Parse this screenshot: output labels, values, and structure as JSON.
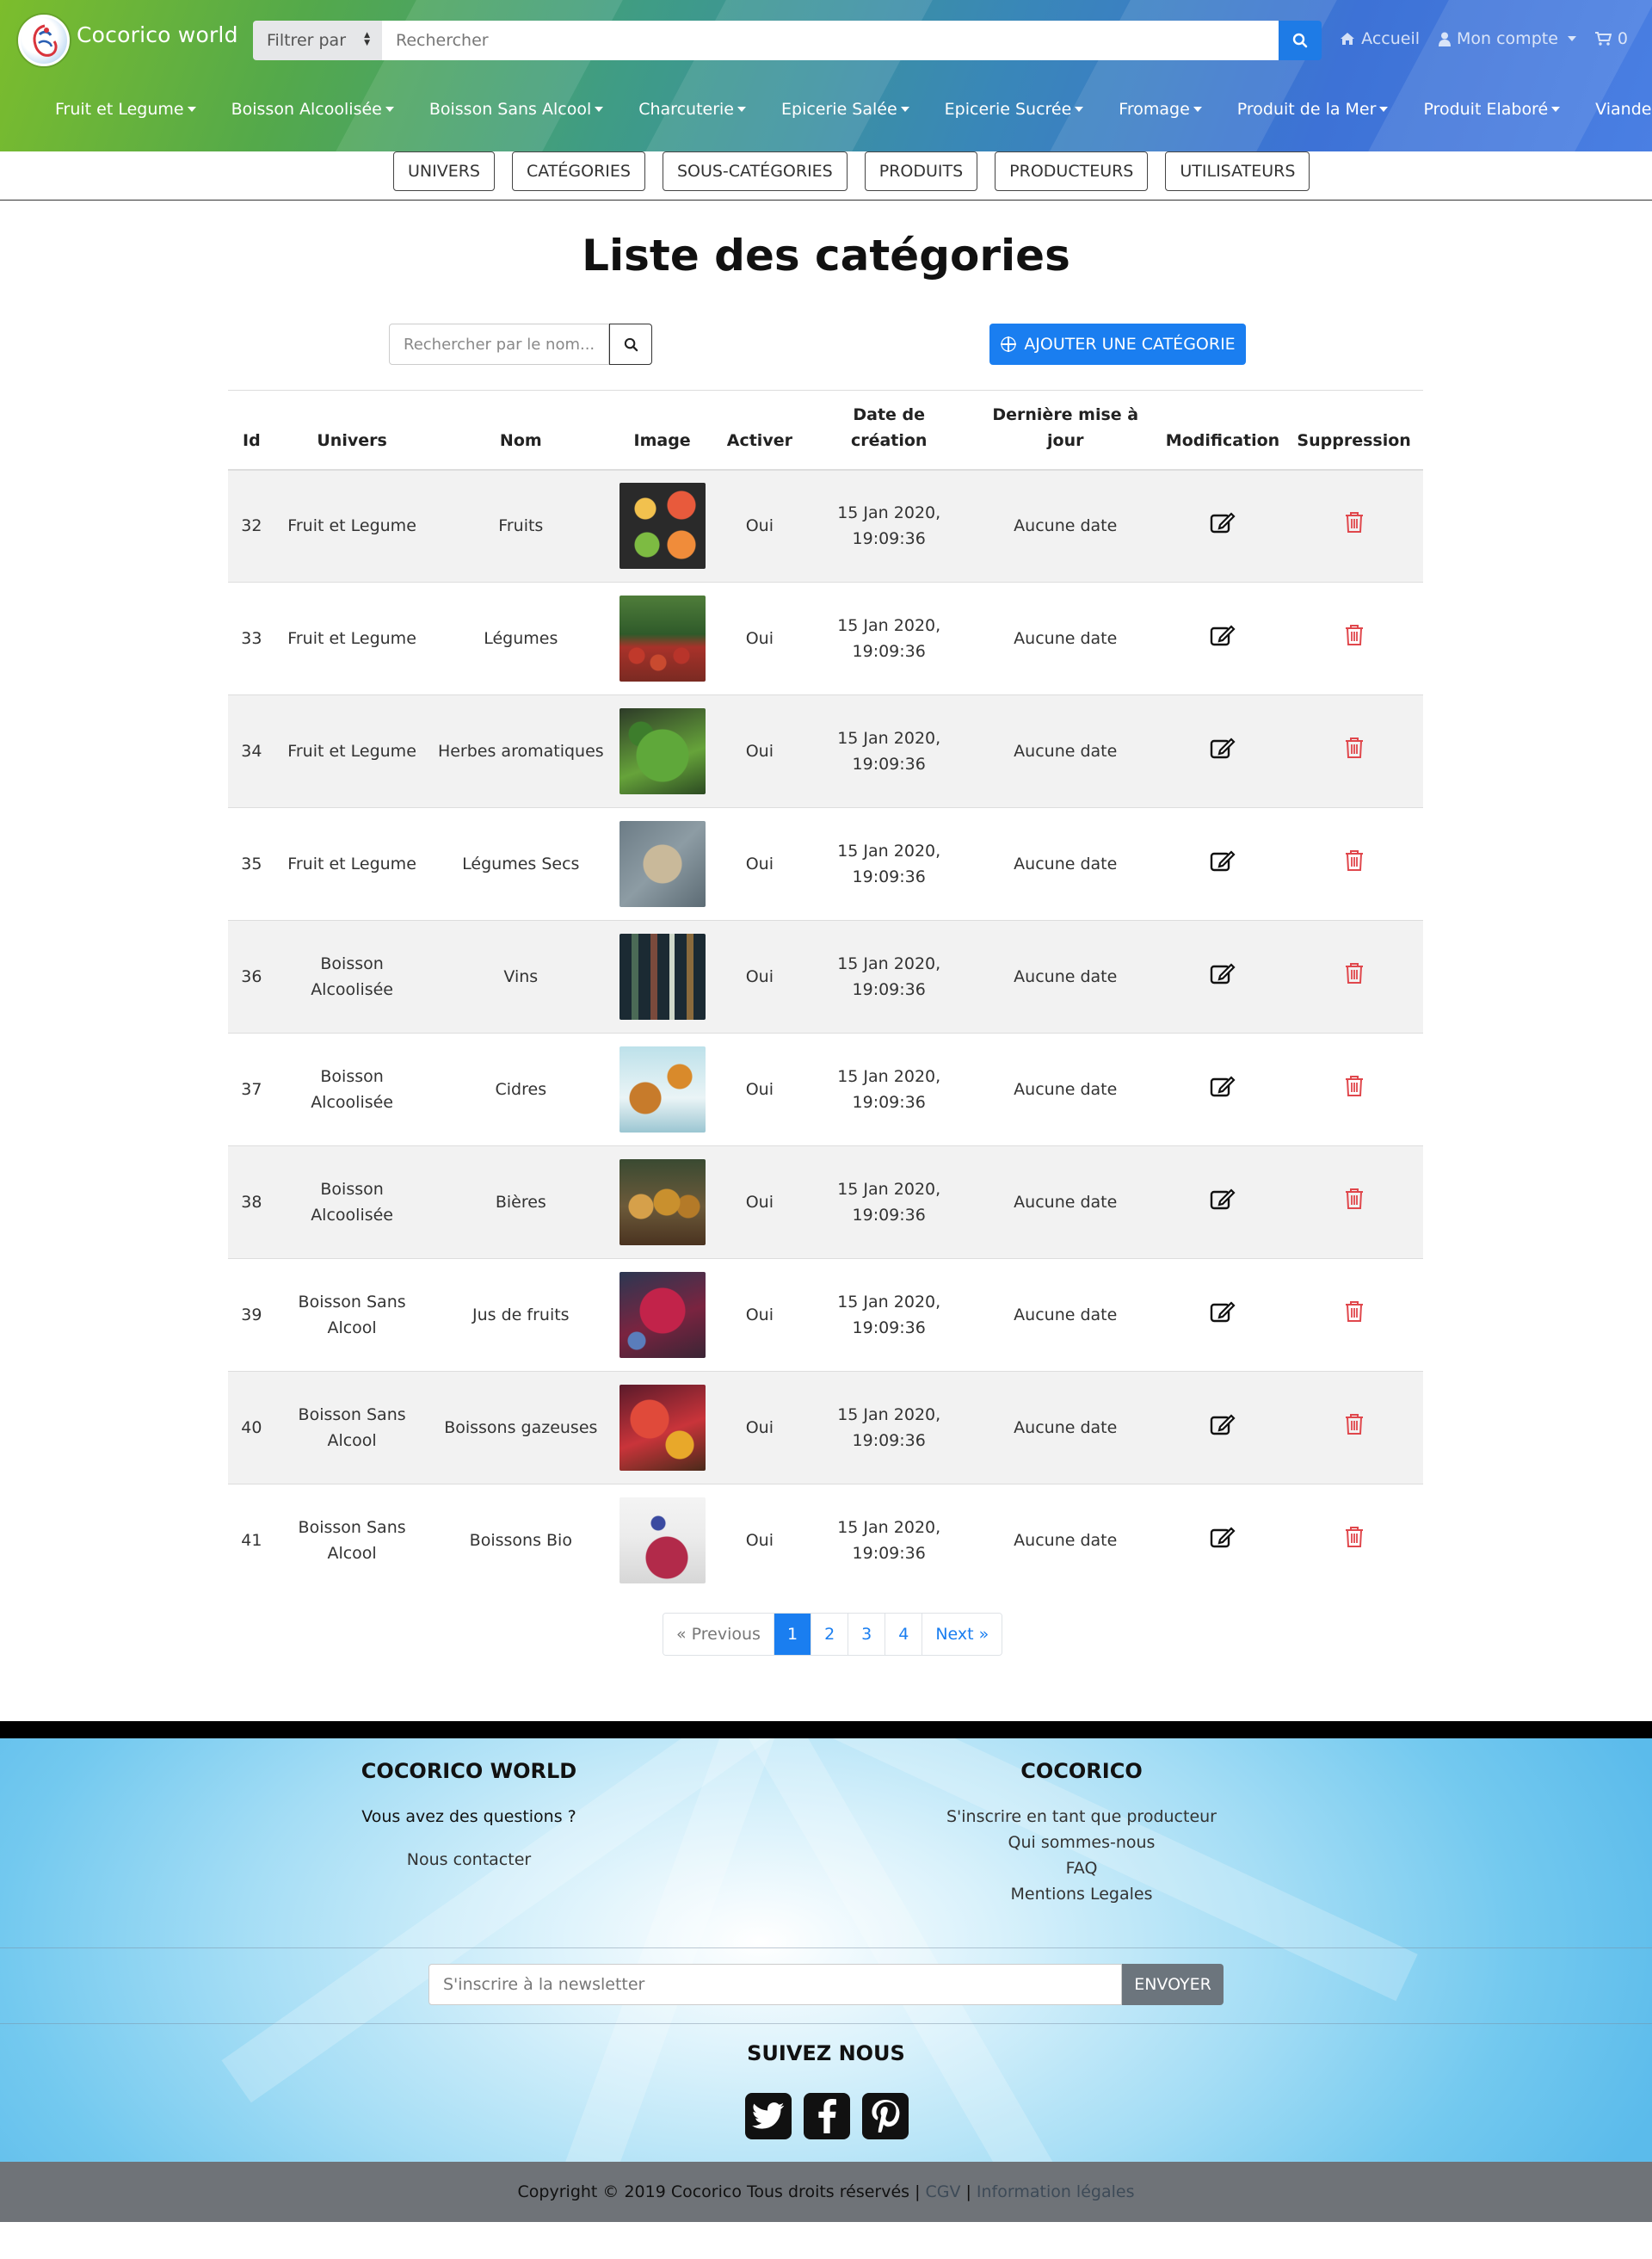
{
  "header": {
    "brand": "Cocorico world",
    "filter_label": "Filtrer par",
    "search_placeholder": "Rechercher",
    "nav": {
      "home": "Accueil",
      "account": "Mon compte",
      "cart_count": "0"
    },
    "categories": [
      "Fruit et Legume",
      "Boisson Alcoolisée",
      "Boisson Sans Alcool",
      "Charcuterie",
      "Epicerie Salée",
      "Epicerie Sucrée",
      "Fromage",
      "Produit de la Mer",
      "Produit Elaboré",
      "Viande"
    ]
  },
  "admin_tabs": [
    "UNIVERS",
    "CATÉGORIES",
    "SOUS-CATÉGORIES",
    "PRODUITS",
    "PRODUCTEURS",
    "UTILISATEURS"
  ],
  "main": {
    "title": "Liste des catégories",
    "name_search_placeholder": "Rechercher par le nom...",
    "add_button": "AJOUTER UNE CATÉGORIE",
    "columns": [
      "Id",
      "Univers",
      "Nom",
      "Image",
      "Activer",
      "Date de création",
      "Dernière mise à jour",
      "Modification",
      "Suppression"
    ],
    "rows": [
      {
        "id": "32",
        "univers": "Fruit et Legume",
        "nom": "Fruits",
        "activer": "Oui",
        "date": "15 Jan 2020, 19:09:36",
        "maj": "Aucune date"
      },
      {
        "id": "33",
        "univers": "Fruit et Legume",
        "nom": "Légumes",
        "activer": "Oui",
        "date": "15 Jan 2020, 19:09:36",
        "maj": "Aucune date"
      },
      {
        "id": "34",
        "univers": "Fruit et Legume",
        "nom": "Herbes aromatiques",
        "activer": "Oui",
        "date": "15 Jan 2020, 19:09:36",
        "maj": "Aucune date"
      },
      {
        "id": "35",
        "univers": "Fruit et Legume",
        "nom": "Légumes Secs",
        "activer": "Oui",
        "date": "15 Jan 2020, 19:09:36",
        "maj": "Aucune date"
      },
      {
        "id": "36",
        "univers": "Boisson Alcoolisée",
        "nom": "Vins",
        "activer": "Oui",
        "date": "15 Jan 2020, 19:09:36",
        "maj": "Aucune date"
      },
      {
        "id": "37",
        "univers": "Boisson Alcoolisée",
        "nom": "Cidres",
        "activer": "Oui",
        "date": "15 Jan 2020, 19:09:36",
        "maj": "Aucune date"
      },
      {
        "id": "38",
        "univers": "Boisson Alcoolisée",
        "nom": "Bières",
        "activer": "Oui",
        "date": "15 Jan 2020, 19:09:36",
        "maj": "Aucune date"
      },
      {
        "id": "39",
        "univers": "Boisson Sans Alcool",
        "nom": "Jus de fruits",
        "activer": "Oui",
        "date": "15 Jan 2020, 19:09:36",
        "maj": "Aucune date"
      },
      {
        "id": "40",
        "univers": "Boisson Sans Alcool",
        "nom": "Boissons gazeuses",
        "activer": "Oui",
        "date": "15 Jan 2020, 19:09:36",
        "maj": "Aucune date"
      },
      {
        "id": "41",
        "univers": "Boisson Sans Alcool",
        "nom": "Boissons Bio",
        "activer": "Oui",
        "date": "15 Jan 2020, 19:09:36",
        "maj": "Aucune date"
      }
    ],
    "pagination": {
      "previous": "« Previous",
      "pages": [
        "1",
        "2",
        "3",
        "4"
      ],
      "active_page": "1",
      "next": "Next »"
    }
  },
  "footer": {
    "col1": {
      "title": "COCORICO WORLD",
      "question": "Vous avez des questions ?",
      "contact": "Nous contacter"
    },
    "col2": {
      "title": "COCORICO",
      "links": [
        "S'inscrire en tant que producteur",
        "Qui sommes-nous",
        "FAQ",
        "Mentions Legales"
      ]
    },
    "newsletter_placeholder": "S'inscrire à la newsletter",
    "newsletter_button": "ENVOYER",
    "follow_title": "SUIVEZ NOUS",
    "socials": [
      "twitter-icon",
      "facebook-icon",
      "pinterest-icon"
    ],
    "copyright": "Copyright © 2019 Cocorico Tous droits réservés |",
    "cgv": "CGV",
    "sep": "|",
    "legal": "Information légales"
  },
  "colors": {
    "primary": "#1a7ef0",
    "delete": "#e0474c",
    "stripe": "#f2f2f2"
  }
}
